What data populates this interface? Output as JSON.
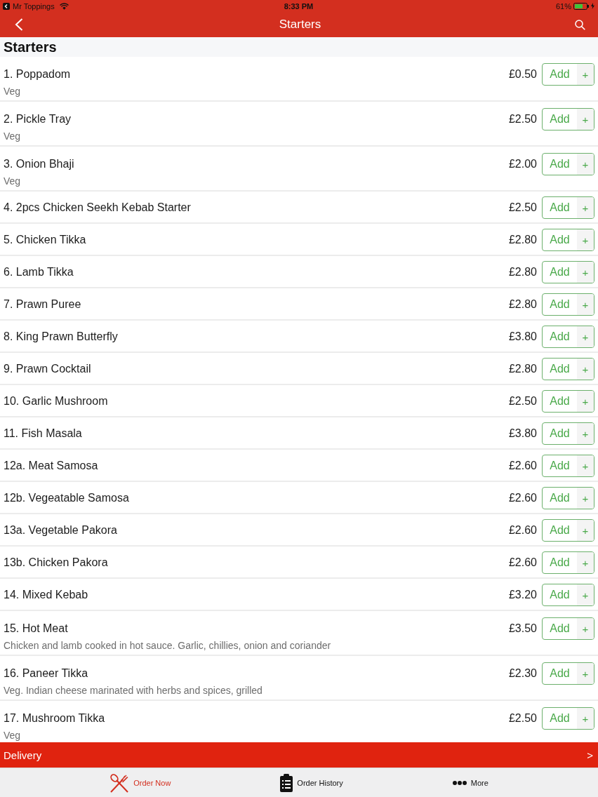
{
  "status_bar": {
    "carrier": "Mr Toppings",
    "time": "8:33 PM",
    "battery": "61%"
  },
  "nav_bar": {
    "title": "Starters"
  },
  "section": {
    "title": "Starters"
  },
  "items": [
    {
      "name": "1. Poppadom",
      "price": "£0.50",
      "description": "Veg",
      "button": "Add",
      "button_plus": "+"
    },
    {
      "name": "2. Pickle Tray",
      "price": "£2.50",
      "description": "Veg",
      "button": "Add",
      "button_plus": "+"
    },
    {
      "name": "3. Onion Bhaji",
      "price": "£2.00",
      "description": "Veg",
      "button": "Add",
      "button_plus": "+"
    },
    {
      "name": "4. 2pcs Chicken Seekh Kebab Starter",
      "price": "£2.50",
      "button": "Add",
      "button_plus": "+"
    },
    {
      "name": "5. Chicken Tikka",
      "price": "£2.80",
      "button": "Add",
      "button_plus": "+"
    },
    {
      "name": "6. Lamb Tikka",
      "price": "£2.80",
      "button": "Add",
      "button_plus": "+"
    },
    {
      "name": "7. Prawn Puree",
      "price": "£2.80",
      "button": "Add",
      "button_plus": "+"
    },
    {
      "name": "8. King Prawn Butterfly",
      "price": "£3.80",
      "button": "Add",
      "button_plus": "+"
    },
    {
      "name": "9. Prawn Cocktail",
      "price": "£2.80",
      "button": "Add",
      "button_plus": "+"
    },
    {
      "name": "10. Garlic Mushroom",
      "price": "£2.50",
      "button": "Add",
      "button_plus": "+"
    },
    {
      "name": "11. Fish Masala",
      "price": "£3.80",
      "button": "Add",
      "button_plus": "+"
    },
    {
      "name": "12a. Meat Samosa",
      "price": "£2.60",
      "button": "Add",
      "button_plus": "+"
    },
    {
      "name": "12b. Vegeatable Samosa",
      "price": "£2.60",
      "button": "Add",
      "button_plus": "+"
    },
    {
      "name": "13a. Vegetable Pakora",
      "price": "£2.60",
      "button": "Add",
      "button_plus": "+"
    },
    {
      "name": "13b. Chicken Pakora",
      "price": "£2.60",
      "button": "Add",
      "button_plus": "+"
    },
    {
      "name": "14. Mixed Kebab",
      "price": "£3.20",
      "button": "Add",
      "button_plus": "+"
    },
    {
      "name": "15. Hot Meat",
      "price": "£3.50",
      "description": "Chicken and lamb cooked in hot sauce. Garlic, chillies, onion and coriander",
      "button": "Add",
      "button_plus": "+"
    },
    {
      "name": "16. Paneer Tikka",
      "price": "£2.30",
      "description": "Veg. Indian cheese marinated with herbs and spices, grilled",
      "button": "Add",
      "button_plus": "+"
    },
    {
      "name": "17. Mushroom Tikka",
      "price": "£2.50",
      "description": "Veg",
      "button": "Add",
      "button_plus": "+"
    }
  ],
  "delivery_bar": {
    "label": "Delivery",
    "arrow": ">"
  },
  "tabs": [
    {
      "label": "Order Now",
      "selected": true
    },
    {
      "label": "Order History",
      "selected": false
    },
    {
      "label": "More",
      "selected": false
    }
  ]
}
